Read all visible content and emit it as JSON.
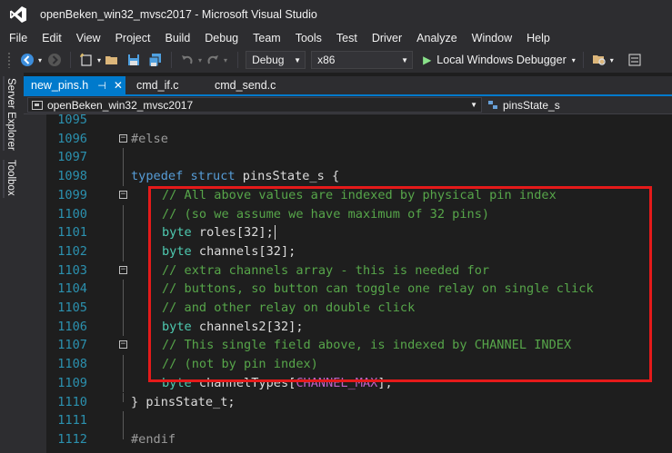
{
  "window": {
    "title": "openBeken_win32_mvsc2017 - Microsoft Visual Studio",
    "logo_icon": "visual-studio-logo-icon"
  },
  "menu": [
    "File",
    "Edit",
    "View",
    "Project",
    "Build",
    "Debug",
    "Team",
    "Tools",
    "Test",
    "Driver",
    "Analyze",
    "Window",
    "Help"
  ],
  "toolbar": {
    "configuration": "Debug",
    "platform": "x86",
    "run_label": "Local Windows Debugger",
    "icons": [
      "back-icon",
      "forward-icon",
      "new-project-icon",
      "open-file-icon",
      "save-icon",
      "save-all-icon",
      "undo-icon",
      "redo-icon",
      "play-icon",
      "find-in-files-icon",
      "properties-icon"
    ]
  },
  "side_rail": {
    "server_explorer": "Server Explorer",
    "toolbox": "Toolbox"
  },
  "tabs": [
    {
      "label": "new_pins.h",
      "active": true
    },
    {
      "label": "cmd_if.c",
      "active": false
    },
    {
      "label": "cmd_send.c",
      "active": false
    }
  ],
  "nav": {
    "project": "openBeken_win32_mvsc2017",
    "symbol": "pinsState_s"
  },
  "code": {
    "line_numbers": [
      "1095",
      "1096",
      "1097",
      "1098",
      "1099",
      "1100",
      "1101",
      "1102",
      "1103",
      "1104",
      "1105",
      "1106",
      "1107",
      "1108",
      "1109",
      "1110",
      "1111",
      "1112"
    ],
    "l1096": "#else",
    "l1098_kw1": "typedef",
    "l1098_kw2": "struct",
    "l1098_rest": " pinsState_s {",
    "l1099": "// All above values are indexed by physical pin index",
    "l1100": "// (so we assume we have maximum of 32 pins)",
    "l1101_type": "byte",
    "l1101_rest": " roles[32];",
    "l1102_type": "byte",
    "l1102_rest": " channels[32];",
    "l1103": "// extra channels array - this is needed for",
    "l1104": "// buttons, so button can toggle one relay on single click",
    "l1105": "// and other relay on double click",
    "l1106_type": "byte",
    "l1106_rest": " channels2[32];",
    "l1107": "// This single field above, is indexed by CHANNEL INDEX",
    "l1108": "// (not by pin index)",
    "l1109_type": "byte",
    "l1109_mid": " channelTypes[",
    "l1109_macro": "CHANNEL_MAX",
    "l1109_end": "];",
    "l1110": "} pinsState_t;",
    "l1112": "#endif"
  },
  "colors": {
    "highlight_border": "#e51a1a",
    "accent": "#007acc",
    "comment": "#57a64a",
    "keyword": "#569cd6",
    "type": "#4ec9b0",
    "macro": "#bd63c5",
    "line_number": "#2b91af"
  }
}
